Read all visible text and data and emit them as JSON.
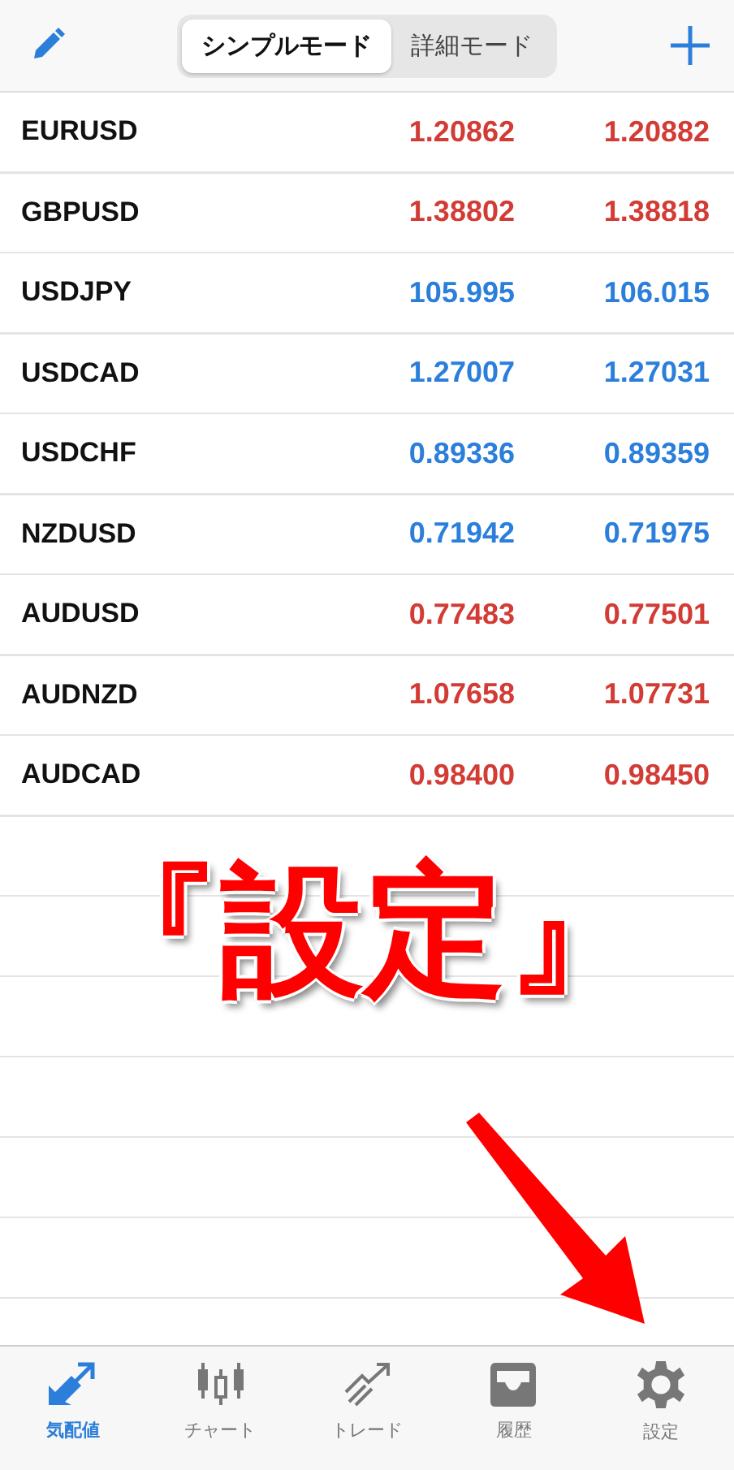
{
  "header": {
    "modes": [
      {
        "label": "シンプルモード",
        "selected": true
      },
      {
        "label": "詳細モード",
        "selected": false
      }
    ]
  },
  "quotes": [
    {
      "symbol": "EURUSD",
      "bid": "1.20862",
      "ask": "1.20882",
      "color": "#d33b35"
    },
    {
      "symbol": "GBPUSD",
      "bid": "1.38802",
      "ask": "1.38818",
      "color": "#d33b35"
    },
    {
      "symbol": "USDJPY",
      "bid": "105.995",
      "ask": "106.015",
      "color": "#2b7fdb"
    },
    {
      "symbol": "USDCAD",
      "bid": "1.27007",
      "ask": "1.27031",
      "color": "#2b7fdb"
    },
    {
      "symbol": "USDCHF",
      "bid": "0.89336",
      "ask": "0.89359",
      "color": "#2b7fdb"
    },
    {
      "symbol": "NZDUSD",
      "bid": "0.71942",
      "ask": "0.71975",
      "color": "#2b7fdb"
    },
    {
      "symbol": "AUDUSD",
      "bid": "0.77483",
      "ask": "0.77501",
      "color": "#d33b35"
    },
    {
      "symbol": "AUDNZD",
      "bid": "1.07658",
      "ask": "1.07731",
      "color": "#d33b35"
    },
    {
      "symbol": "AUDCAD",
      "bid": "0.98400",
      "ask": "0.98450",
      "color": "#d33b35"
    }
  ],
  "annotation": {
    "text": "『設定』"
  },
  "tab_bar": [
    {
      "label": "気配値",
      "kind": "quotes",
      "selected": true
    },
    {
      "label": "チャート",
      "kind": "chart",
      "selected": false
    },
    {
      "label": "トレード",
      "kind": "trade",
      "selected": false
    },
    {
      "label": "履歴",
      "kind": "history",
      "selected": false
    },
    {
      "label": "設定",
      "kind": "settings",
      "selected": false
    }
  ]
}
